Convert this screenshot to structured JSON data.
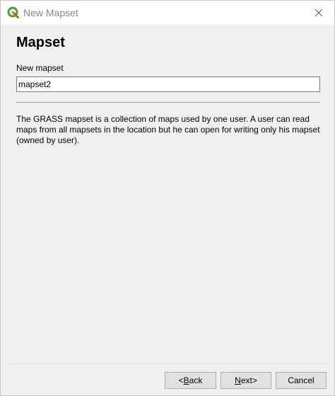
{
  "window": {
    "title": "New Mapset",
    "app_icon": "qgis-logo-icon",
    "close_icon": "close-icon"
  },
  "page": {
    "heading": "Mapset",
    "field_label": "New mapset",
    "field_value": "mapset2",
    "description": "The GRASS mapset is a collection of maps used by one user. A user can read maps from all mapsets in the location but he can open for writing only his mapset (owned by user)."
  },
  "buttons": {
    "back_prefix": "< ",
    "back_mnemonic": "B",
    "back_rest": "ack",
    "next_mnemonic": "N",
    "next_rest": "ext",
    "next_suffix": " >",
    "cancel": "Cancel"
  },
  "colors": {
    "logo_green": "#589632",
    "logo_yellow": "#ee7913",
    "title_text": "#8a8a8a",
    "background": "#f0f0f0"
  }
}
